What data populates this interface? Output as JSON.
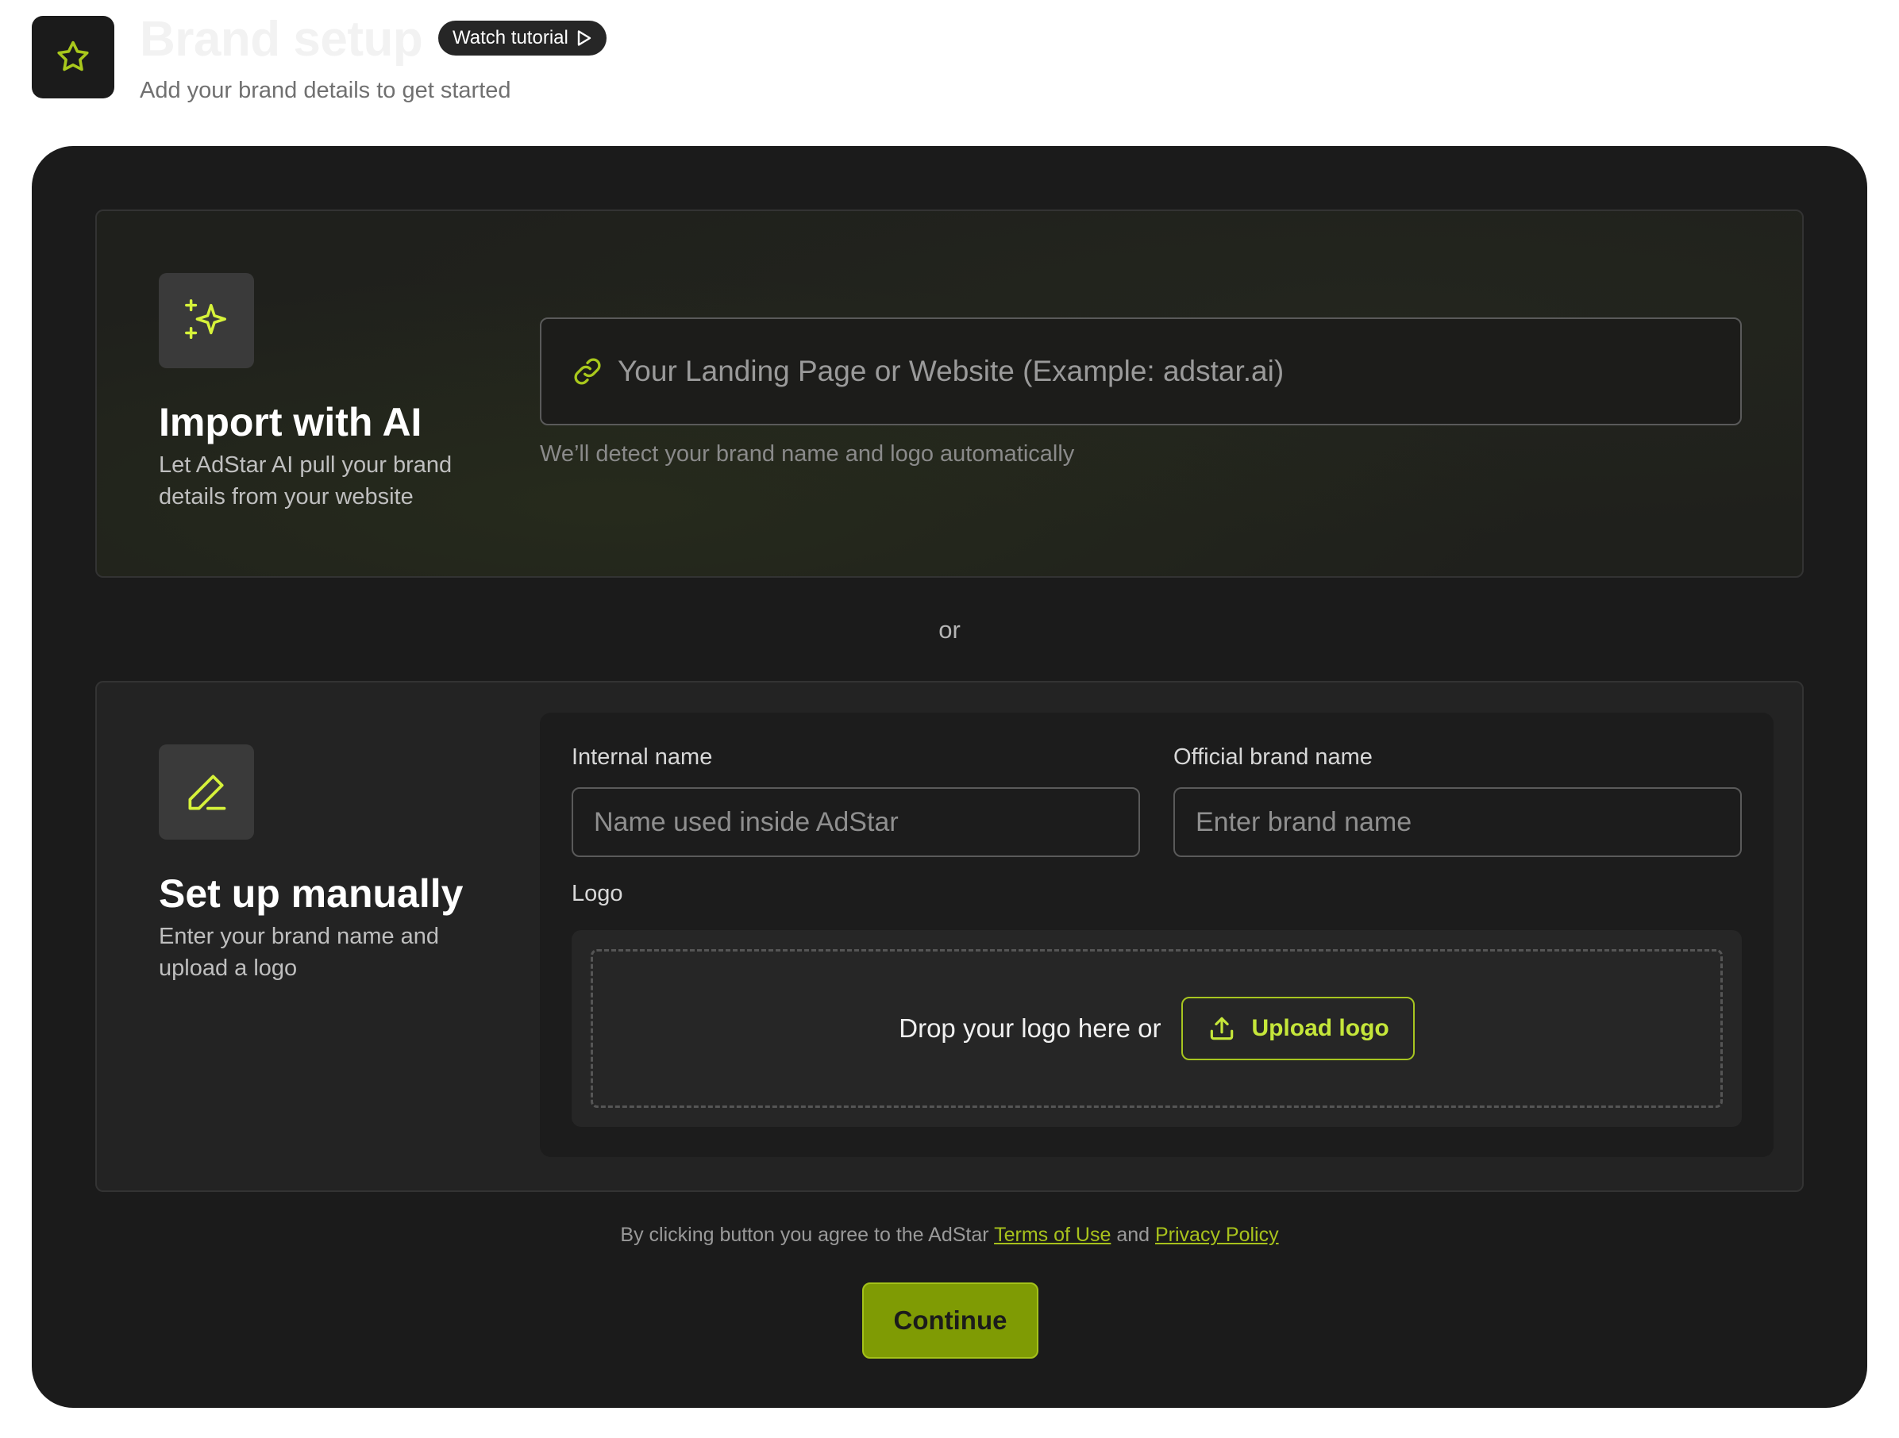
{
  "header": {
    "title": "Brand setup",
    "tutorial_label": "Watch tutorial",
    "subtitle": "Add your brand details to get started"
  },
  "import_ai": {
    "heading": "Import with AI",
    "description": "Let AdStar AI pull your brand details from your website",
    "url_placeholder": "Your Landing Page or Website (Example: adstar.ai)",
    "url_value": "",
    "hint": "We’ll detect your brand name and logo automatically"
  },
  "divider": {
    "text": "or"
  },
  "manual": {
    "heading": "Set up manually",
    "description": "Enter your brand name and upload a logo",
    "internal_name_label": "Internal name",
    "internal_name_placeholder": "Name used inside AdStar",
    "internal_name_value": "",
    "brand_name_label": "Official brand name",
    "brand_name_placeholder": "Enter brand name",
    "brand_name_value": "",
    "logo_label": "Logo",
    "drop_text": "Drop your logo here or",
    "upload_label": "Upload logo"
  },
  "footer": {
    "terms_prefix": "By clicking button you agree to the AdStar",
    "terms_link": "Terms of Use",
    "terms_and": "and",
    "privacy_link": "Privacy Policy",
    "continue_label": "Continue"
  },
  "icons": {
    "app": "star-icon",
    "tutorial": "play-icon",
    "ai": "sparkles-icon",
    "url": "link-icon",
    "manual": "pencil-icon",
    "upload": "upload-icon"
  },
  "colors": {
    "accent": "#c5e63a",
    "accent_dark": "#7f9b04",
    "card_bg": "#1b1b1b",
    "panel_bg": "#232323"
  }
}
